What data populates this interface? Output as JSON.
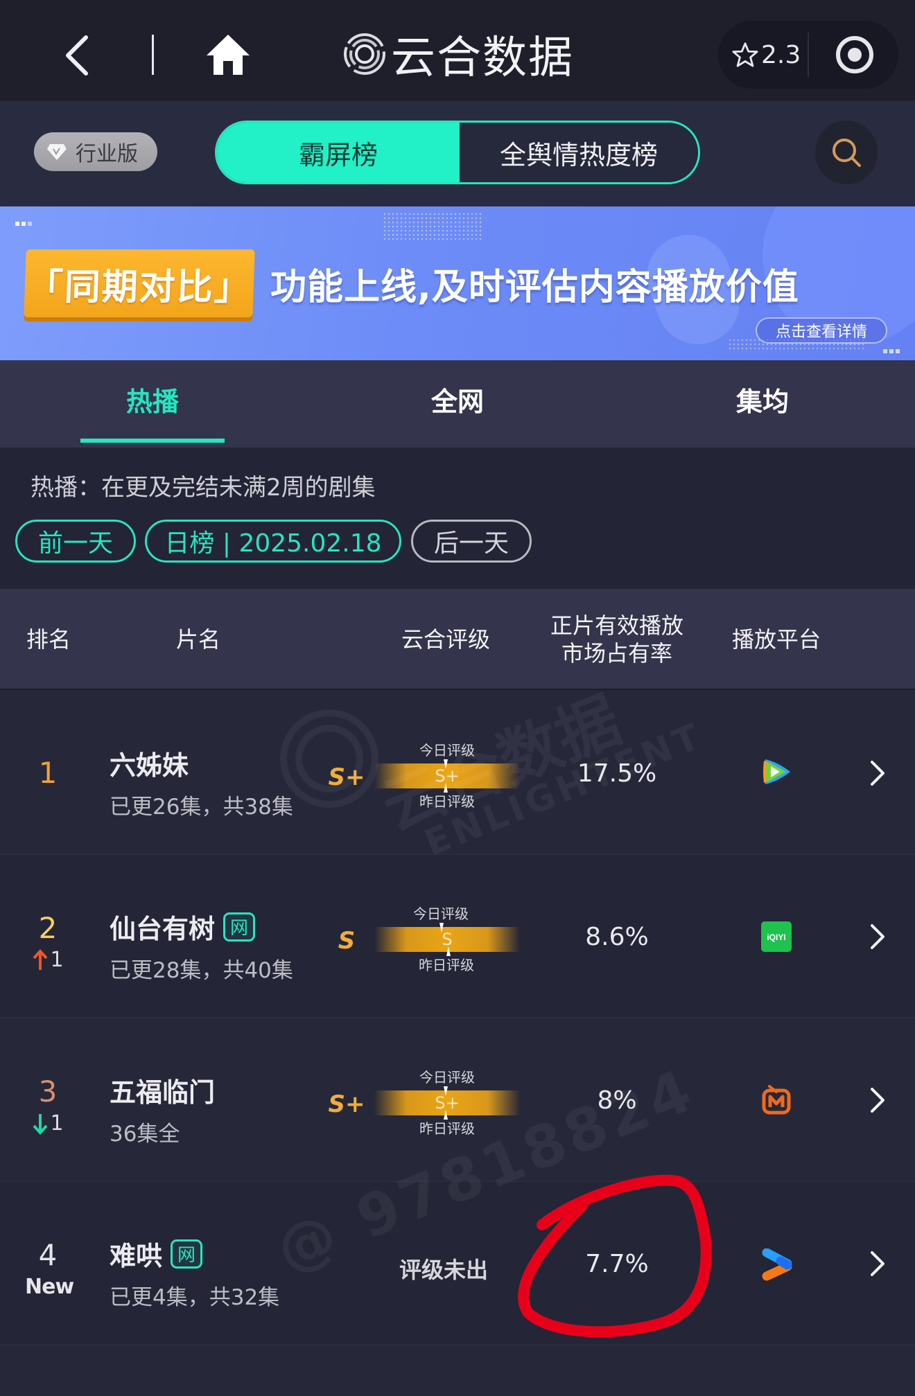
{
  "topbar": {
    "brand_name": "云合数据",
    "rating_value": "2.3",
    "icons": {
      "back": "chevron-left-icon",
      "home": "home-icon",
      "logo": "yunhe-logo-icon",
      "star": "star-outline-icon",
      "target": "target-icon"
    }
  },
  "segbar": {
    "industry_badge": "行业版",
    "tabs": [
      {
        "label": "霸屏榜",
        "active": true
      },
      {
        "label": "全舆情热度榜",
        "active": false
      }
    ],
    "search_icon": "search-icon"
  },
  "banner": {
    "tag": "「同期对比」",
    "headline": "功能上线,及时评估内容播放价值",
    "cta": "点击查看详情"
  },
  "subtabs": [
    {
      "label": "热播",
      "active": true
    },
    {
      "label": "全网",
      "active": false
    },
    {
      "label": "集均",
      "active": false
    }
  ],
  "info": {
    "description": "热播：在更及完结未满2周的剧集",
    "prev_day": "前一天",
    "date_label": "日榜 | 2025.02.18",
    "next_day": "后一天"
  },
  "table": {
    "headers": {
      "rank": "排名",
      "title": "片名",
      "grade": "云合评级",
      "share_line1": "正片有效播放",
      "share_line2": "市场占有率",
      "platform": "播放平台"
    },
    "grade_today_label": "今日评级",
    "grade_yesterday_label": "昨日评级",
    "rows": [
      {
        "rank": "1",
        "rank_color": "#f1a13a",
        "change": "",
        "change_dir": "none",
        "title": "六姊妹",
        "net_badge": "",
        "episodes": "已更26集，共38集",
        "grade": "S+",
        "grade_meter_value": "S+",
        "share": "17.5%",
        "platform": "tencent-video"
      },
      {
        "rank": "2",
        "rank_color": "#f7cf5b",
        "change": "1",
        "change_dir": "up",
        "title": "仙台有树",
        "net_badge": "网",
        "episodes": "已更28集，共40集",
        "grade": "S",
        "grade_meter_value": "S",
        "share": "8.6%",
        "platform": "iqiyi"
      },
      {
        "rank": "3",
        "rank_color": "#d9906d",
        "change": "1",
        "change_dir": "down",
        "title": "五福临门",
        "net_badge": "",
        "episodes": "36集全",
        "grade": "S+",
        "grade_meter_value": "S+",
        "share": "8%",
        "platform": "mango-tv"
      },
      {
        "rank": "4",
        "rank_color": "#e4e4ea",
        "change": "New",
        "change_dir": "new",
        "title": "难哄",
        "net_badge": "网",
        "episodes": "已更4集，共32集",
        "grade": "",
        "grade_none": "评级未出",
        "share": "7.7%",
        "platform": "youku"
      }
    ]
  },
  "platform_labels": {
    "iqiyi": "iQIYI"
  },
  "watermark": {
    "brand": "云合数据",
    "sub": "ENLIGHTENT",
    "id": "@ 97818824"
  },
  "colors": {
    "accent": "#25e6c0",
    "grade_gold": "#f1ad3b",
    "annotation_red": "#e8001a"
  }
}
